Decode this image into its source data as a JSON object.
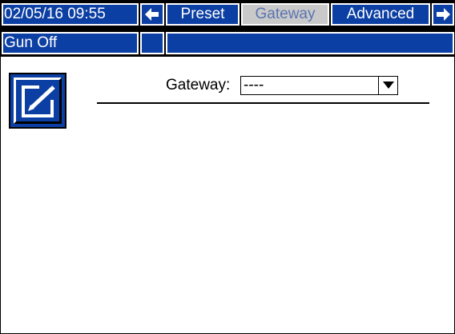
{
  "header": {
    "datetime": "02/05/16 09:55",
    "prev_arrow": "🡐",
    "tabs": [
      {
        "label": "Preset",
        "active": false
      },
      {
        "label": "Gateway",
        "active": true
      },
      {
        "label": "Advanced",
        "active": false
      }
    ],
    "next_arrow": "🡒"
  },
  "status": {
    "text": "Gun Off"
  },
  "form": {
    "gateway_label": "Gateway:",
    "gateway_value": "----"
  },
  "icons": {
    "edit": "edit-pencil-icon",
    "dropdown": "triangle-down-icon"
  },
  "colors": {
    "accent": "#0c3fa3",
    "active_tab_bg": "#c9c9c9",
    "active_tab_text": "#5a74b0"
  }
}
